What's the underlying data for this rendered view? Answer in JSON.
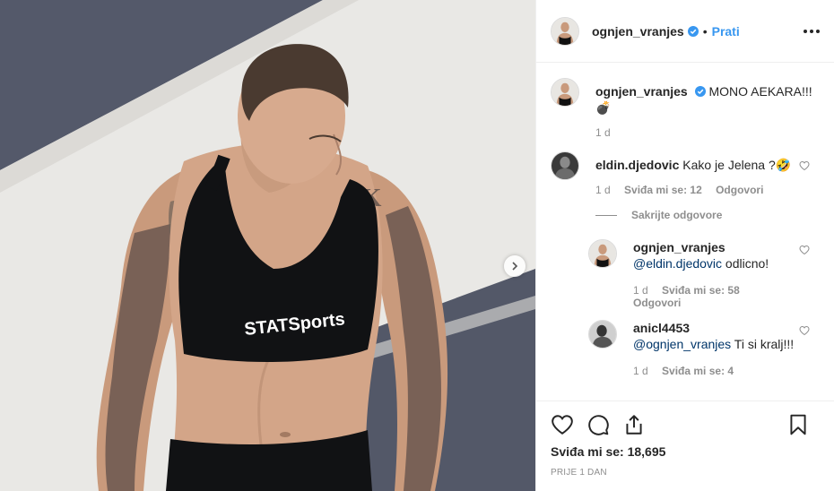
{
  "post": {
    "username": "ognjen_vranjes",
    "dot": "•",
    "follow_label": "Prati",
    "caption": "MONO AEKARA!!!",
    "caption_emoji": "💣",
    "caption_time": "1 d"
  },
  "comments": [
    {
      "username": "eldin.djedovic",
      "text": "Kako je Jelena ?",
      "emoji": "🤣",
      "time": "1 d",
      "likes": "Sviđa mi se: 12",
      "reply_label": "Odgovori",
      "hide_replies_label": "Sakrijte odgovore"
    }
  ],
  "replies": [
    {
      "username": "ognjen_vranjes",
      "mention": "@eldin.djedovic",
      "text": " odlicno!",
      "time": "1 d",
      "likes": "Sviđa mi se: 58",
      "reply_label": "Odgovori"
    },
    {
      "username": "anicl4453",
      "mention": "@ognjen_vranjes",
      "text": " Ti si kralj!!!",
      "time": "1 d",
      "likes": "Sviđa mi se: 4"
    }
  ],
  "footer": {
    "likes_count": "Sviđa mi se: 18,695",
    "posted": "PRIJE 1 DAN"
  },
  "photo": {
    "shirt_brand": "STATSports",
    "tattoo_letters": "EK"
  },
  "colors": {
    "accent": "#3897f0",
    "verified": "#3897f0",
    "mention": "#003569",
    "muted": "#8e8e8e"
  },
  "icons": {
    "more": "more-options-icon",
    "like": "heart-icon",
    "comment": "comment-icon",
    "share": "share-icon",
    "save": "bookmark-icon",
    "next": "chevron-right-icon"
  }
}
